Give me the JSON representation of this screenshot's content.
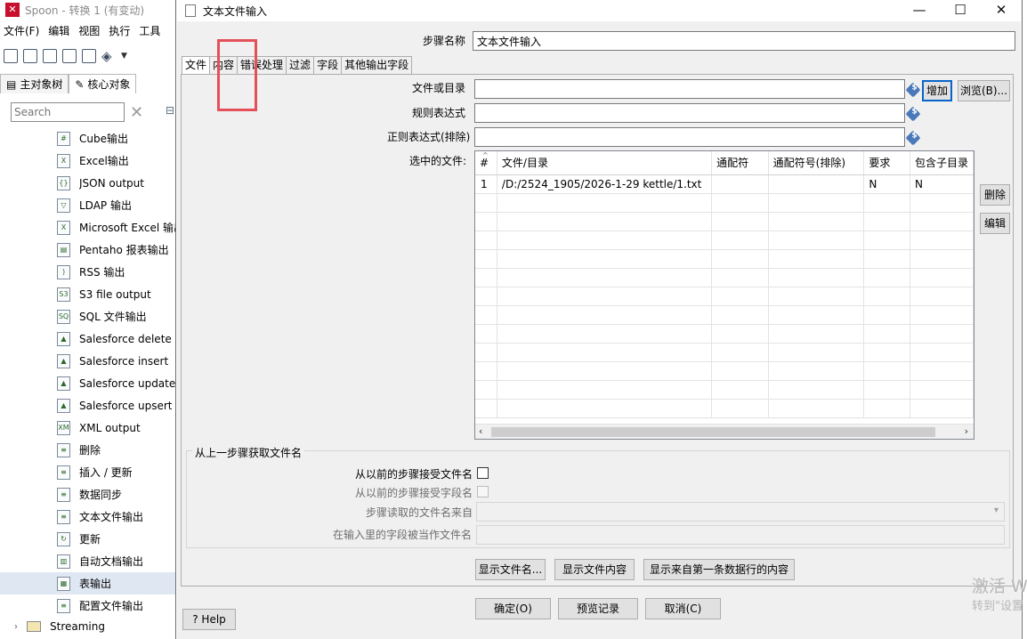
{
  "spoon": {
    "title": "Spoon - 转换 1 (有变动)",
    "menu": [
      "文件(F)",
      "编辑",
      "视图",
      "执行",
      "工具"
    ],
    "tabs": [
      "主对象树",
      "核心对象"
    ],
    "search_placeholder": "Search",
    "items": [
      {
        "label": "Cube输出",
        "icon": "cube-output-icon",
        "glyph": "#"
      },
      {
        "label": "Excel输出",
        "icon": "excel-icon",
        "glyph": "X"
      },
      {
        "label": "JSON output",
        "icon": "json-icon",
        "glyph": "{}"
      },
      {
        "label": "LDAP 输出",
        "icon": "ldap-icon",
        "glyph": "▽"
      },
      {
        "label": "Microsoft Excel 输出",
        "icon": "excel-icon",
        "glyph": "X"
      },
      {
        "label": "Pentaho 报表输出",
        "icon": "report-icon",
        "glyph": "▤"
      },
      {
        "label": "RSS 输出",
        "icon": "rss-icon",
        "glyph": ")"
      },
      {
        "label": "S3 file output",
        "icon": "s3-icon",
        "glyph": "S3"
      },
      {
        "label": "SQL 文件输出",
        "icon": "sql-icon",
        "glyph": "SQ"
      },
      {
        "label": "Salesforce delete",
        "icon": "salesforce-icon",
        "glyph": "▲"
      },
      {
        "label": "Salesforce insert",
        "icon": "salesforce-icon",
        "glyph": "▲"
      },
      {
        "label": "Salesforce update",
        "icon": "salesforce-icon",
        "glyph": "▲"
      },
      {
        "label": "Salesforce upsert",
        "icon": "salesforce-icon",
        "glyph": "▲"
      },
      {
        "label": "XML output",
        "icon": "xml-icon",
        "glyph": "XM"
      },
      {
        "label": "删除",
        "icon": "delete-db-icon",
        "glyph": "≡"
      },
      {
        "label": "插入 / 更新",
        "icon": "insert-update-icon",
        "glyph": "≡"
      },
      {
        "label": "数据同步",
        "icon": "sync-icon",
        "glyph": "≡"
      },
      {
        "label": "文本文件输出",
        "icon": "text-file-icon",
        "glyph": "≡"
      },
      {
        "label": "更新",
        "icon": "refresh-icon",
        "glyph": "↻"
      },
      {
        "label": "自动文档输出",
        "icon": "doc-icon",
        "glyph": "▥"
      },
      {
        "label": "表输出",
        "icon": "table-icon",
        "glyph": "▦",
        "selected": true
      },
      {
        "label": "配置文件输出",
        "icon": "config-file-icon",
        "glyph": "≡"
      }
    ],
    "streaming_label": "Streaming"
  },
  "dialog": {
    "title": "文本文件输入",
    "step_name_label": "步骤名称",
    "step_name_value": "文本文件输入",
    "tabs": [
      "文件",
      "内容",
      "错误处理",
      "过滤",
      "字段",
      "其他输出字段"
    ],
    "file_label": "文件或目录",
    "regex_label": "规则表达式",
    "exclude_regex_label": "正则表达式(排除)",
    "selected_files_label": "选中的文件:",
    "add_button": "增加",
    "browse_button": "浏览(B)...",
    "delete_button": "删除",
    "edit_button": "编辑",
    "table": {
      "columns": [
        "#",
        "文件/目录",
        "通配符",
        "通配符号(排除)",
        "要求",
        "包含子目录"
      ],
      "rows": [
        [
          "1",
          "/D:/2524_1905/2026-1-29 kettle/1.txt",
          "",
          "",
          "N",
          "N"
        ]
      ]
    },
    "group_title": "从上一步骤获取文件名",
    "accept_filenames_label": "从以前的步骤接受文件名",
    "accept_fields_label": "从以前的步骤接受字段名",
    "step_source_label": "步骤读取的文件名来自",
    "field_as_filename_label": "在输入里的字段被当作文件名",
    "show_filenames_button": "显示文件名...",
    "show_file_content_button": "显示文件内容",
    "show_first_row_button": "显示来自第一条数据行的内容",
    "ok_button": "确定(O)",
    "preview_button": "预览记录",
    "cancel_button": "取消(C)",
    "help_button": "Help"
  },
  "watermark": {
    "line1": "激活 W",
    "line2": "转到\"设置"
  }
}
